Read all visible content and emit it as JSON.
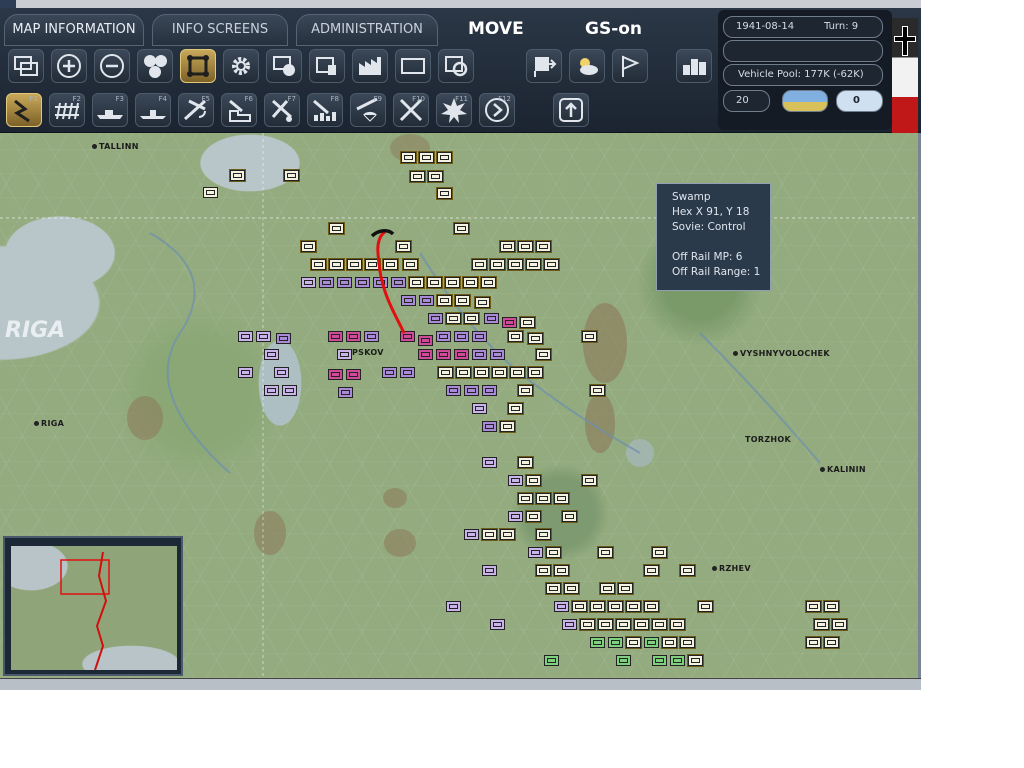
{
  "tabs": [
    {
      "label": "MAP INFORMATION"
    },
    {
      "label": "INFO SCREENS"
    },
    {
      "label": "ADMINISTRATION"
    }
  ],
  "mode": {
    "phase": "MOVE",
    "gs": "GS-on"
  },
  "info": {
    "date": "1941-08-14",
    "turn": "Turn: 9",
    "vehicle_pool": "Vehicle Pool: 177K (-62K)",
    "value_left": "20",
    "value_right": "0"
  },
  "toolbar_row1": [
    {
      "icon": "layers-icon"
    },
    {
      "icon": "zoom-in-icon"
    },
    {
      "icon": "zoom-out-icon"
    },
    {
      "icon": "hex-grid-icon"
    },
    {
      "icon": "unit-frame-icon",
      "active": true
    },
    {
      "icon": "gear-icon"
    },
    {
      "icon": "unit-stack-icon"
    },
    {
      "icon": "depot-icon"
    },
    {
      "icon": "factory-icon"
    },
    {
      "icon": "rectangle-icon"
    },
    {
      "icon": "settings-box-icon"
    },
    {
      "icon": "flag-box-icon"
    },
    {
      "icon": "weather-icon"
    },
    {
      "icon": "flag-icon"
    },
    {
      "icon": "blocks-icon"
    }
  ],
  "toolbar_row2": [
    {
      "icon": "move-mode-icon",
      "key": "F1",
      "active": true
    },
    {
      "icon": "rail-icon",
      "key": "F2"
    },
    {
      "icon": "naval-icon",
      "key": "F3"
    },
    {
      "icon": "naval-transport-icon",
      "key": "F4"
    },
    {
      "icon": "air-recon-icon",
      "key": "F5"
    },
    {
      "icon": "air-transport-icon",
      "key": "F6"
    },
    {
      "icon": "air-attack-icon",
      "key": "F7"
    },
    {
      "icon": "air-base-icon",
      "key": "F8"
    },
    {
      "icon": "paradrop-icon",
      "key": "F9"
    },
    {
      "icon": "air-interdiction-icon",
      "key": "F10"
    },
    {
      "icon": "explosion-icon",
      "key": "F11"
    },
    {
      "icon": "next-unit-icon",
      "key": "F12"
    },
    {
      "icon": "upload-icon",
      "key": ""
    }
  ],
  "tooltip": {
    "terrain": "Swamp",
    "hex": "Hex X 91, Y 18",
    "control": "Sovie: Control",
    "mp": "Off Rail MP: 6",
    "range": "Off Rail Range: 1"
  },
  "cities": [
    {
      "name": "TALLINN"
    },
    {
      "name": "RIGA"
    },
    {
      "name": "VYSHNYVOLOCHEK"
    },
    {
      "name": "TORZHOK"
    },
    {
      "name": "KALININ"
    },
    {
      "name": "RZHEV"
    },
    {
      "name": "PSKOV"
    }
  ],
  "sea_label": "RIGA",
  "colors": {
    "panel": "#222c38",
    "active_button": "#c8a95a",
    "arrow": "#e01010",
    "german_unit": "#f3f1df",
    "soviet_unit": "#a98ad6"
  }
}
